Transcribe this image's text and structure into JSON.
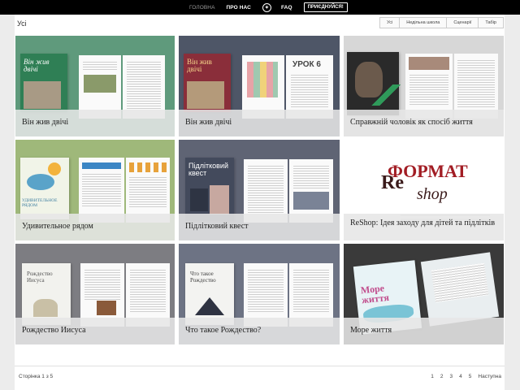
{
  "nav": {
    "home": "ГОЛОВНА",
    "about": "ПРО НАС",
    "faq": "FAQ",
    "join": "ПРИЄДНУЙСЯ!"
  },
  "heading": "Усі",
  "filters": [
    "Усі",
    "Недільна школа",
    "Сценарії",
    "Табір"
  ],
  "cards": [
    {
      "title": "Він жив двічі",
      "bg": "#5f9a7c"
    },
    {
      "title": "Він жив двічі",
      "bg": "#4e5667"
    },
    {
      "title": "Справжній чоловік як спосіб життя",
      "bg": "#d7d7d7"
    },
    {
      "title": "Удивительное рядом",
      "bg": "#9fb87a"
    },
    {
      "title": "Підлітковий квест",
      "bg": "#5f6474"
    },
    {
      "title": "ReShop: Ідея заходу для дітей та підлітків",
      "bg": "#ffffff"
    },
    {
      "title": "Рождество Иисуса",
      "bg": "#7d7d82"
    },
    {
      "title": "Что такое Рождество?",
      "bg": "#6d7384"
    },
    {
      "title": "Море життя",
      "bg": "#3a3a3a"
    }
  ],
  "covers": {
    "c0": "Він жив двічі",
    "c1": "Він жив двічі",
    "c1b": "УРОК 6",
    "c3": "УДИВИТЕЛЬНОЕ РЯДОМ",
    "c4": "Підлітковий квест",
    "c6": "Рождество Иисуса",
    "c7": "Что такое Рождество",
    "c8": "Море життя"
  },
  "reshop": {
    "brand": "ФОРМАТ",
    "re": "Re",
    "shop": "shop"
  },
  "footer": {
    "page_info": "Сторінка 1 з 5",
    "pages": [
      "1",
      "2",
      "3",
      "4",
      "5"
    ],
    "next": "Наступна"
  }
}
